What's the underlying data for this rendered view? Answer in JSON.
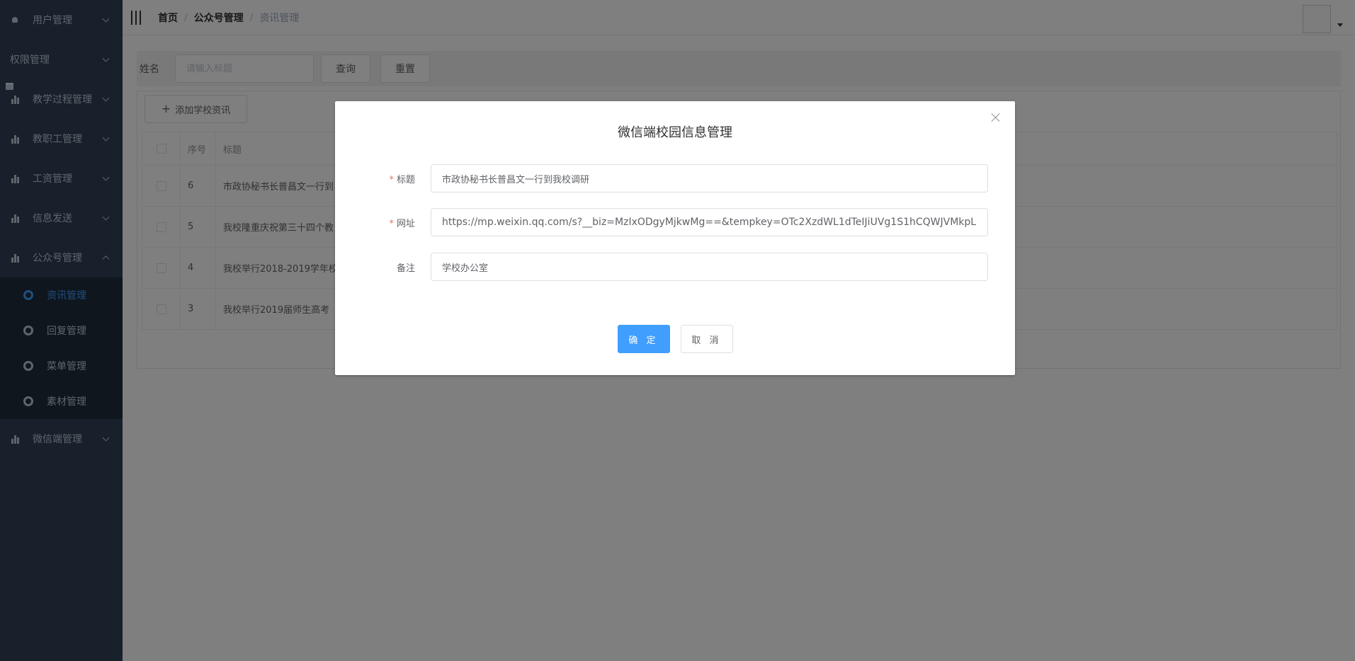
{
  "sidebar": {
    "items": [
      {
        "label": "用户管理",
        "icon": "user-icon"
      },
      {
        "label": "权限管理",
        "icon": "table-icon"
      },
      {
        "label": "教学过程管理",
        "icon": "bar-chart-icon"
      },
      {
        "label": "教职工管理",
        "icon": "bar-chart-icon"
      },
      {
        "label": "工资管理",
        "icon": "bar-chart-icon"
      },
      {
        "label": "信息发送",
        "icon": "bar-chart-icon"
      },
      {
        "label": "公众号管理",
        "icon": "bar-chart-icon"
      },
      {
        "label": "微信端管理",
        "icon": "bar-chart-icon"
      }
    ],
    "submenu": [
      {
        "label": "资讯管理",
        "active": true
      },
      {
        "label": "回复管理",
        "active": false
      },
      {
        "label": "菜单管理",
        "active": false
      },
      {
        "label": "素材管理",
        "active": false
      }
    ]
  },
  "breadcrumb": [
    "首页",
    "公众号管理",
    "资讯管理"
  ],
  "search": {
    "label": "姓名",
    "placeholder": "请输入标题",
    "query_label": "查询",
    "reset_label": "重置"
  },
  "table": {
    "add_label": "添加学校资讯",
    "headers": {
      "no": "序号",
      "title": "标题"
    },
    "rows": [
      {
        "no": "6",
        "title": "市政协秘书长普昌文一行到"
      },
      {
        "no": "5",
        "title": "我校隆重庆祝第三十四个教"
      },
      {
        "no": "4",
        "title": "我校举行2018-2019学年校"
      },
      {
        "no": "3",
        "title": "我校举行2019届师生高考"
      }
    ]
  },
  "dialog": {
    "title": "微信端校园信息管理",
    "fields": {
      "title_label": "标题",
      "title_value": "市政协秘书长普昌文一行到我校调研",
      "url_label": "网址",
      "url_value": "https://mp.weixin.qq.com/s?__biz=MzIxODgyMjkwMg==&tempkey=OTc2XzdWL1dTeIJiUVg1S1hCQWJVMkpLam",
      "note_label": "备注",
      "note_value": "学校办公室"
    },
    "confirm_label": "确 定",
    "cancel_label": "取 消"
  },
  "colors": {
    "sidebar_bg": "#304156",
    "submenu_bg": "#1f2d3d",
    "accent": "#409eff",
    "required": "#f56c6c"
  }
}
